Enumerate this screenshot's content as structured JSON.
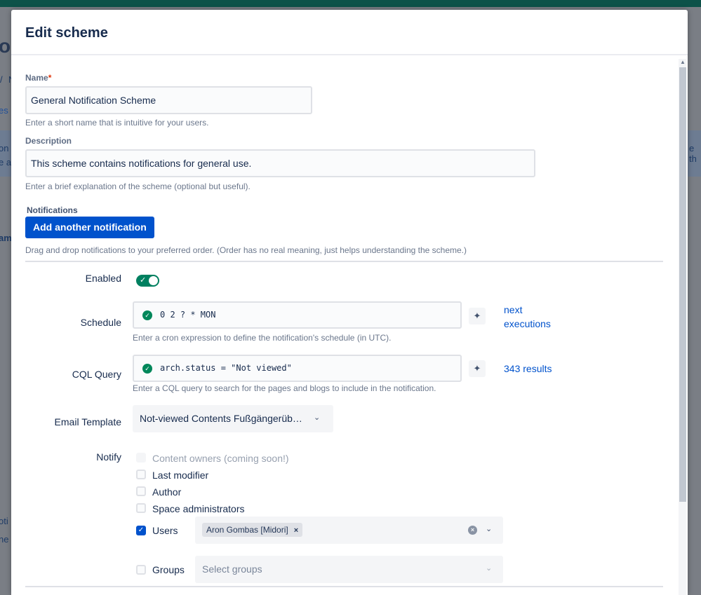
{
  "background": {
    "frag_title": "on",
    "frag_tab": "es",
    "frag_a": "/",
    "frag_b": "N",
    "frag_c": "on",
    "frag_d": "e ab",
    "frag_e": "am",
    "frag_f": "oti",
    "frag_g": "ne c",
    "frag_h": "e th"
  },
  "modal": {
    "title": "Edit scheme"
  },
  "name_field": {
    "label": "Name",
    "required_mark": "*",
    "value": "General Notification Scheme",
    "help": "Enter a short name that is intuitive for your users."
  },
  "description_field": {
    "label": "Description",
    "value": "This scheme contains notifications for general use.",
    "help": "Enter a brief explanation of the scheme (optional but useful)."
  },
  "notifications": {
    "label": "Notifications",
    "add_button": "Add another notification",
    "help": "Drag and drop notifications to your preferred order. (Order has no real meaning, just helps understanding the scheme.)"
  },
  "notification_item": {
    "enabled_label": "Enabled",
    "enabled": true,
    "schedule_label": "Schedule",
    "schedule_value": "0 2 ? * MON",
    "schedule_help": "Enter a cron expression to define the notification's schedule (in UTC).",
    "schedule_link_line1": "next",
    "schedule_link_line2": "executions",
    "cql_label": "CQL Query",
    "cql_value": "arch.status = \"Not viewed\"",
    "cql_help": "Enter a CQL query to search for the pages and blogs to include in the notification.",
    "cql_results_link": "343 results",
    "template_label": "Email Template",
    "template_value": "Not-viewed Contents Fußgängerüb…",
    "notify_label": "Notify",
    "notify_options": [
      {
        "label": "Content owners (coming soon!)",
        "checked": false,
        "disabled": true
      },
      {
        "label": "Last modifier",
        "checked": false,
        "disabled": false
      },
      {
        "label": "Author",
        "checked": false,
        "disabled": false
      },
      {
        "label": "Space administrators",
        "checked": false,
        "disabled": false
      }
    ],
    "users_label": "Users",
    "users_checked": true,
    "users_selected": [
      "Aron Gombas [Midori]"
    ],
    "groups_label": "Groups",
    "groups_checked": false,
    "groups_placeholder": "Select groups"
  },
  "icons": {
    "check": "✓",
    "ai_sparkle": "✦",
    "chevron_down": "⌄",
    "remove": "×",
    "clear": "×",
    "scroll_up": "▲"
  },
  "colors": {
    "primary": "#0052cc",
    "success": "#00875a",
    "toggle_on": "#008060",
    "required": "#de350b"
  }
}
